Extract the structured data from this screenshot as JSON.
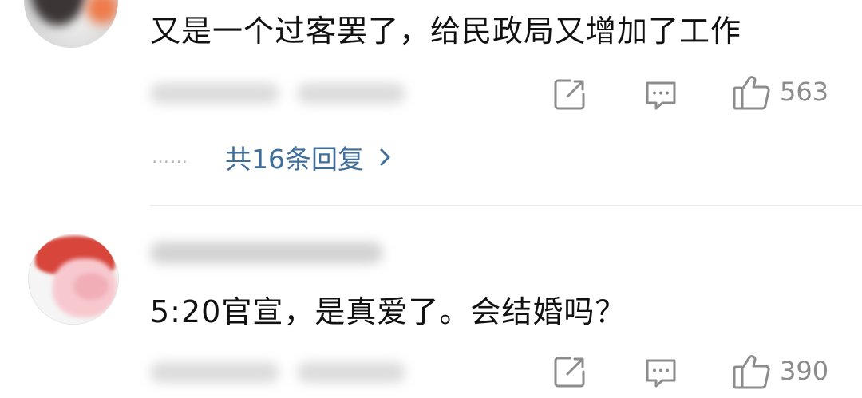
{
  "comments": [
    {
      "text": "又是一个过客罢了，给民政局又增加了工作",
      "like_count": "563",
      "reply_link": "共16条回复",
      "reply_dots": "……"
    },
    {
      "text": "5:20官宣，是真爱了。会结婚吗？",
      "like_count": "390"
    }
  ],
  "icons": {
    "share": "share-icon",
    "comment": "comment-icon",
    "like": "thumbs-up-icon",
    "chevron": "chevron-right-icon"
  },
  "colors": {
    "text": "#111111",
    "muted": "#8c8c8c",
    "link": "#3f6e9a",
    "divider": "#ececec"
  }
}
